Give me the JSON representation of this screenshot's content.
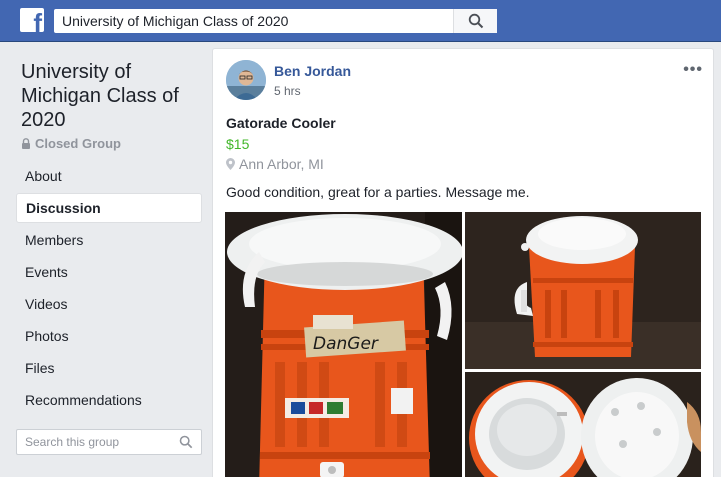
{
  "topbar": {
    "logo_icon": "facebook-f-icon",
    "search_value": "University of Michigan Class of 2020",
    "search_icon": "search-icon"
  },
  "group": {
    "name": "University of Michigan Class of 2020",
    "privacy": "Closed Group",
    "privacy_icon": "lock-icon"
  },
  "nav": {
    "items": [
      {
        "label": "About"
      },
      {
        "label": "Discussion",
        "active": true
      },
      {
        "label": "Members"
      },
      {
        "label": "Events"
      },
      {
        "label": "Videos"
      },
      {
        "label": "Photos"
      },
      {
        "label": "Files"
      },
      {
        "label": "Recommendations"
      }
    ]
  },
  "group_search": {
    "placeholder": "Search this group"
  },
  "post": {
    "author": "Ben Jordan",
    "time": "5 hrs",
    "more_label": "•••",
    "item_title": "Gatorade Cooler",
    "price": "$15",
    "location": "Ann Arbor, MI",
    "description": "Good condition, great for a parties. Message me.",
    "tape_text": "DanGer",
    "photos": [
      "cooler-front-photo",
      "cooler-side-photo",
      "cooler-open-photo"
    ]
  },
  "colors": {
    "brand_blue": "#4267b2",
    "link_blue": "#365899",
    "price_green": "#42b72a",
    "background": "#e9ebee",
    "cooler_orange": "#e8561c"
  }
}
